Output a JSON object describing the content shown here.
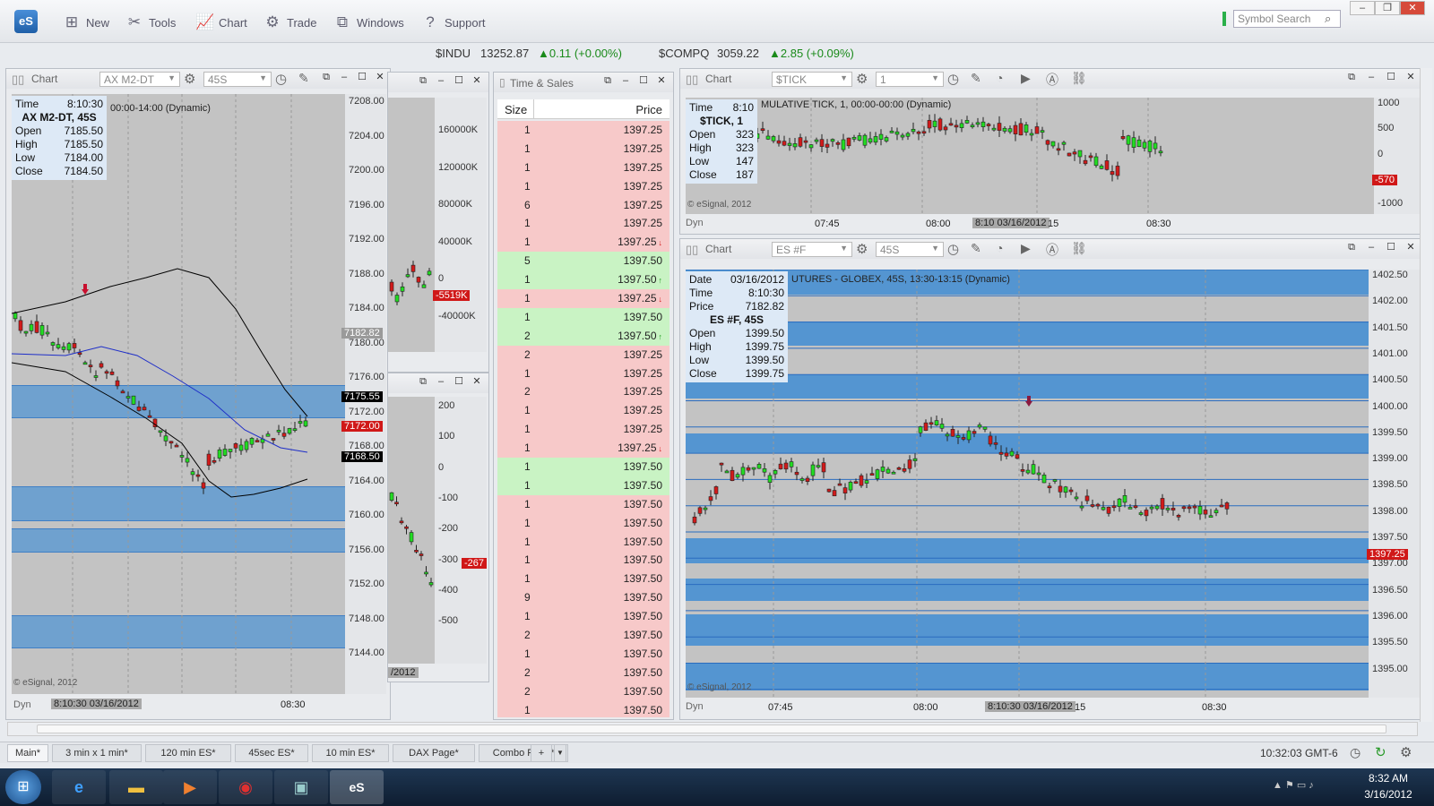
{
  "app": {
    "logo": "eS"
  },
  "toolbar": {
    "new": "New",
    "tools": "Tools",
    "chart": "Chart",
    "trade": "Trade",
    "windows": "Windows",
    "support": "Support",
    "search_placeholder": "Symbol Search"
  },
  "ticker": {
    "indu_sym": "$INDU",
    "indu_val": "13252.87",
    "indu_chg": "▲0.11 (+0.00%)",
    "compq_sym": "$COMPQ",
    "compq_val": "3059.22",
    "compq_chg": "▲2.85 (+0.09%)"
  },
  "chart1": {
    "title": "Chart",
    "symbol": "AX M2-DT",
    "interval": "45S",
    "session": "00:00-14:00 (Dynamic)",
    "info": {
      "time_label": "Time",
      "time": "8:10:30",
      "name": "AX M2-DT, 45S",
      "open_label": "Open",
      "open": "7185.50",
      "high_label": "High",
      "high": "7185.50",
      "low_label": "Low",
      "low": "7184.00",
      "close_label": "Close",
      "close": "7184.50"
    },
    "yaxis": [
      "7208.00",
      "7204.00",
      "7200.00",
      "7196.00",
      "7192.00",
      "7188.00",
      "7184.00",
      "7180.00",
      "7176.00",
      "7172.00",
      "7168.00",
      "7164.00",
      "7160.00",
      "7156.00",
      "7152.00",
      "7148.00",
      "7144.00"
    ],
    "labels": {
      "price": "7182.82",
      "upper": "7175.55",
      "last": "7172.00",
      "lower": "7168.50"
    },
    "xlabel": "08:30",
    "dyn": "Dyn",
    "cursor": "8:10:30 03/16/2012",
    "copyright": "© eSignal, 2012"
  },
  "chart2": {
    "yaxis": [
      "160000K",
      "120000K",
      "80000K",
      "40000K",
      "0",
      "-40000K"
    ],
    "label": "-5519K"
  },
  "chart3": {
    "yaxis": [
      "200",
      "100",
      "0",
      "-100",
      "-200",
      "-300",
      "-400",
      "-500"
    ],
    "label": "-267",
    "date": "/2012"
  },
  "ts": {
    "title": "Time & Sales",
    "size_hdr": "Size",
    "price_hdr": "Price",
    "rows": [
      {
        "s": "1",
        "p": "1397.25",
        "c": "d"
      },
      {
        "s": "1",
        "p": "1397.25",
        "c": "d"
      },
      {
        "s": "1",
        "p": "1397.25",
        "c": "d"
      },
      {
        "s": "1",
        "p": "1397.25",
        "c": "d"
      },
      {
        "s": "6",
        "p": "1397.25",
        "c": "d"
      },
      {
        "s": "1",
        "p": "1397.25",
        "c": "d"
      },
      {
        "s": "1",
        "p": "1397.25",
        "c": "d",
        "a": "↓"
      },
      {
        "s": "5",
        "p": "1397.50",
        "c": "u"
      },
      {
        "s": "1",
        "p": "1397.50",
        "c": "u",
        "a": "↑"
      },
      {
        "s": "1",
        "p": "1397.25",
        "c": "d",
        "a": "↓"
      },
      {
        "s": "1",
        "p": "1397.50",
        "c": "u"
      },
      {
        "s": "2",
        "p": "1397.50",
        "c": "u",
        "a": "↑"
      },
      {
        "s": "2",
        "p": "1397.25",
        "c": "d"
      },
      {
        "s": "1",
        "p": "1397.25",
        "c": "d"
      },
      {
        "s": "2",
        "p": "1397.25",
        "c": "d"
      },
      {
        "s": "1",
        "p": "1397.25",
        "c": "d"
      },
      {
        "s": "1",
        "p": "1397.25",
        "c": "d"
      },
      {
        "s": "1",
        "p": "1397.25",
        "c": "d",
        "a": "↓"
      },
      {
        "s": "1",
        "p": "1397.50",
        "c": "u"
      },
      {
        "s": "1",
        "p": "1397.50",
        "c": "u"
      },
      {
        "s": "1",
        "p": "1397.50",
        "c": "d"
      },
      {
        "s": "1",
        "p": "1397.50",
        "c": "d"
      },
      {
        "s": "1",
        "p": "1397.50",
        "c": "d"
      },
      {
        "s": "1",
        "p": "1397.50",
        "c": "d"
      },
      {
        "s": "1",
        "p": "1397.50",
        "c": "d"
      },
      {
        "s": "9",
        "p": "1397.50",
        "c": "d"
      },
      {
        "s": "1",
        "p": "1397.50",
        "c": "d"
      },
      {
        "s": "2",
        "p": "1397.50",
        "c": "d"
      },
      {
        "s": "1",
        "p": "1397.50",
        "c": "d"
      },
      {
        "s": "2",
        "p": "1397.50",
        "c": "d"
      },
      {
        "s": "2",
        "p": "1397.50",
        "c": "d"
      },
      {
        "s": "1",
        "p": "1397.50",
        "c": "d"
      }
    ]
  },
  "chart4": {
    "title": "Chart",
    "symbol": "$TICK",
    "interval": "1",
    "session": "MULATIVE TICK, 1, 00:00-00:00 (Dynamic)",
    "info": {
      "time_label": "Time",
      "time": "8:10",
      "name": "$TICK, 1",
      "open_label": "Open",
      "open": "323",
      "high_label": "High",
      "high": "323",
      "low_label": "Low",
      "low": "147",
      "close_label": "Close",
      "close": "187"
    },
    "yaxis": [
      "1000",
      "500",
      "0",
      "-1000"
    ],
    "label": "-570",
    "x1": "07:45",
    "x2": "08:00",
    "x3": "08:30",
    "cursor": "8:10 03/16/2012",
    "x_after": "15",
    "dyn": "Dyn",
    "copyright": "© eSignal, 2012"
  },
  "chart5": {
    "title": "Chart",
    "symbol": "ES #F",
    "interval": "45S",
    "session": "UTURES - GLOBEX, 45S, 13:30-13:15 (Dynamic)",
    "info": {
      "date_label": "Date",
      "date": "03/16/2012",
      "time_label": "Time",
      "time": "8:10:30",
      "price_label": "Price",
      "price": "7182.82",
      "name": "ES #F, 45S",
      "open_label": "Open",
      "open": "1399.50",
      "high_label": "High",
      "high": "1399.75",
      "low_label": "Low",
      "low": "1399.50",
      "close_label": "Close",
      "close": "1399.75"
    },
    "yaxis": [
      "1402.50",
      "1402.00",
      "1401.50",
      "1401.00",
      "1400.50",
      "1400.00",
      "1399.50",
      "1399.00",
      "1398.50",
      "1398.00",
      "1397.50",
      "1397.00",
      "1396.50",
      "1396.00",
      "1395.50",
      "1395.00"
    ],
    "label": "1397.25",
    "x1": "07:45",
    "x2": "08:00",
    "x3": "08:30",
    "cursor": "8:10:30 03/16/2012",
    "x_after": "15",
    "dyn": "Dyn",
    "copyright": "© eSignal, 2012"
  },
  "tabs": [
    "Main*",
    "3 min x 1 min*",
    "120 min ES*",
    "45sec ES*",
    "10 min ES*",
    "DAX Page*",
    "Combo Page*"
  ],
  "status": {
    "clock": "10:32:03 GMT-6"
  },
  "taskbar": {
    "time": "8:32 AM",
    "date": "3/16/2012"
  }
}
